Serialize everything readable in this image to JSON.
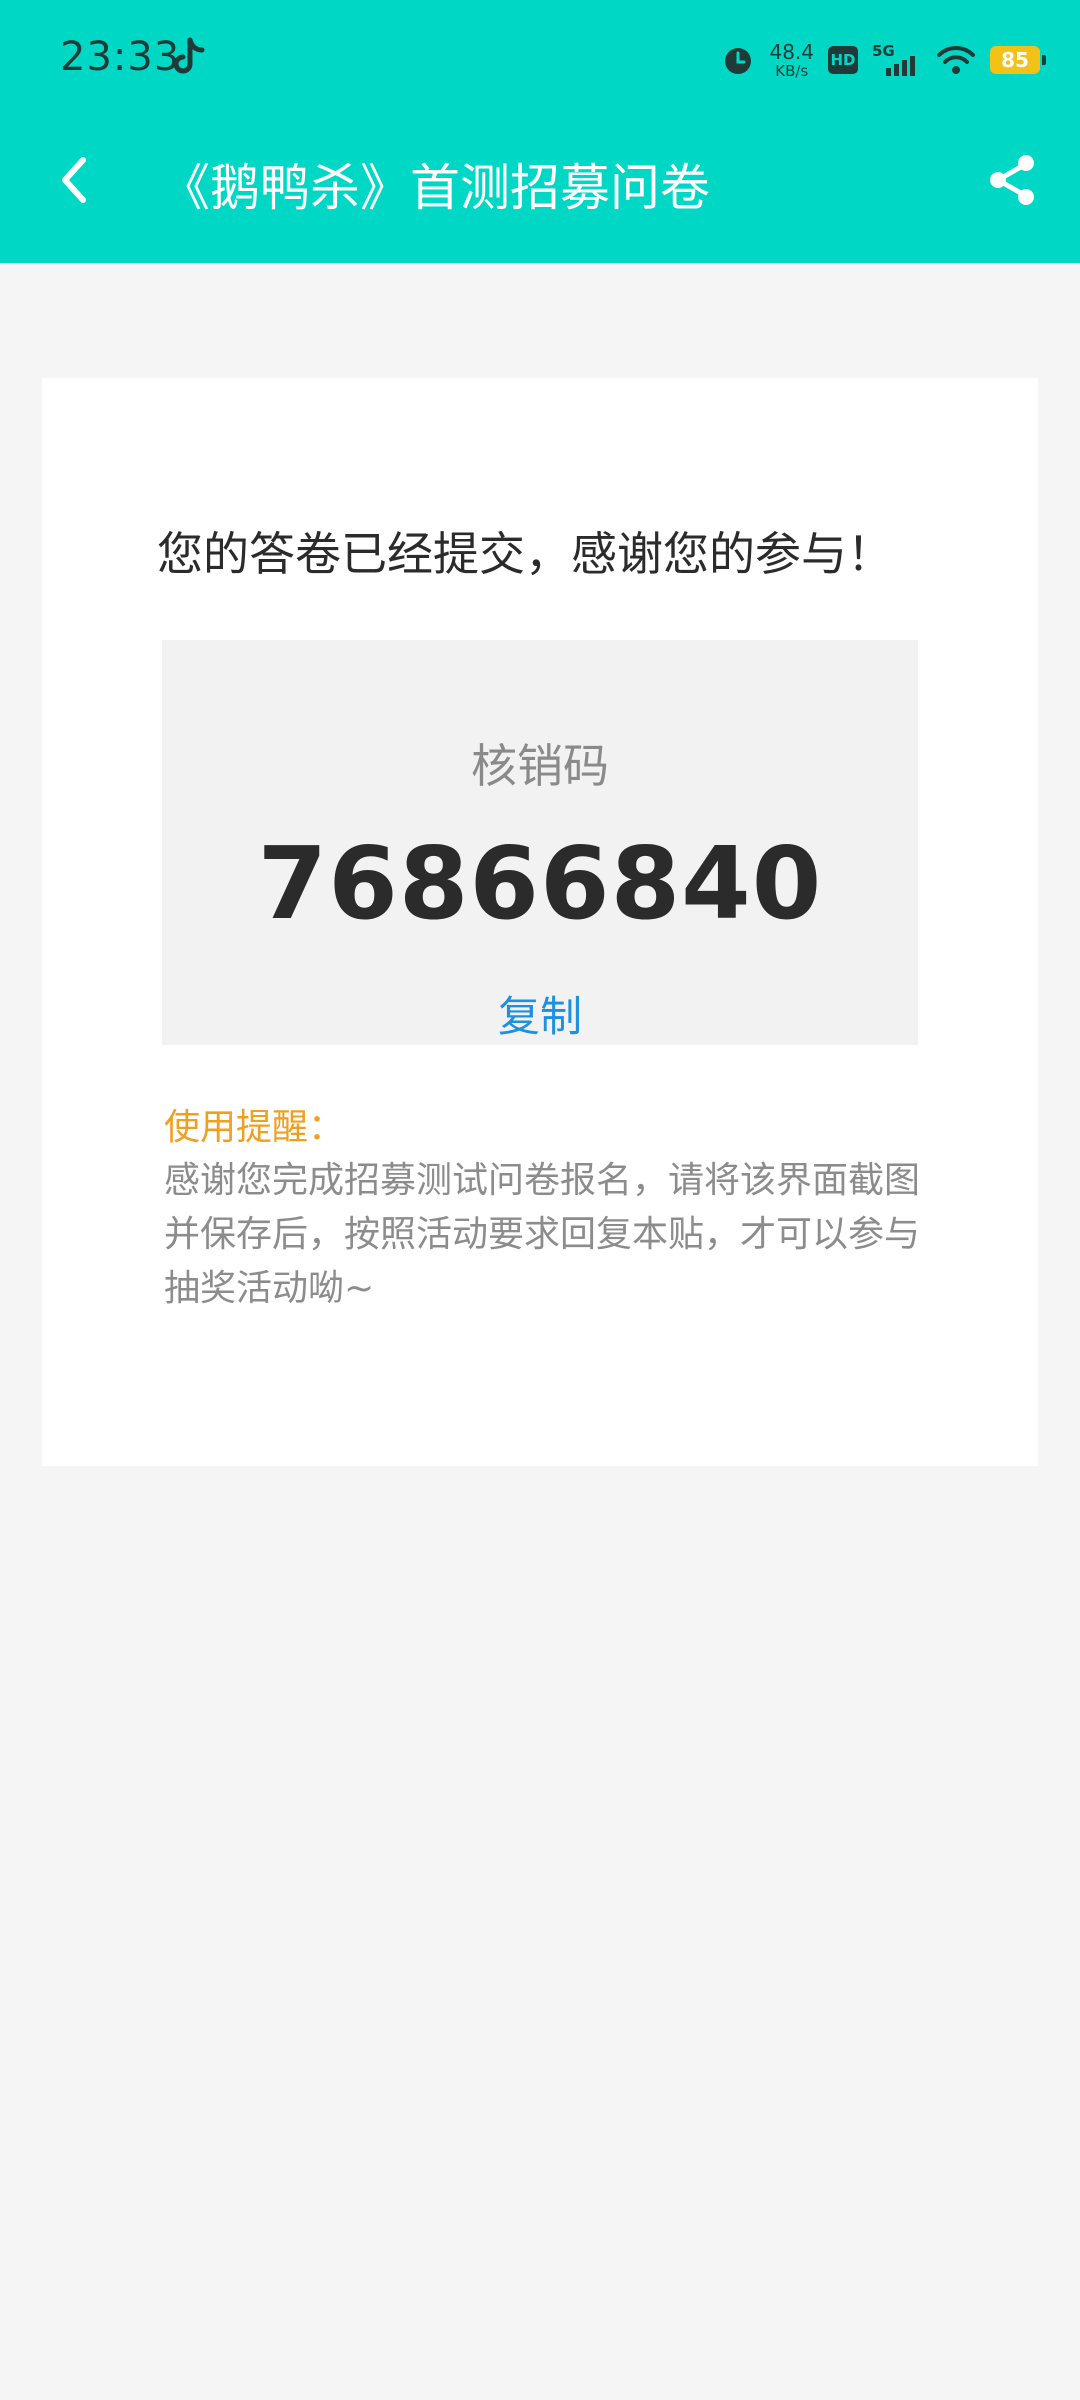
{
  "status_bar": {
    "time": "23:33",
    "net_speed_value": "48.4",
    "net_speed_unit": "KB/s",
    "hd_badge": "HD",
    "signal_label": "5G",
    "battery": "85",
    "icons": [
      "tiktok-icon",
      "alarm-icon",
      "signal-icon",
      "wifi-icon",
      "battery-icon"
    ]
  },
  "header": {
    "title": "《鹅鸭杀》首测招募问卷",
    "icons": [
      "back-arrow-icon",
      "share-icon"
    ]
  },
  "main": {
    "headline": "您的答卷已经提交，感谢您的参与！",
    "code_label": "核销码",
    "code_value": "76866840",
    "copy_label": "复制",
    "tip_title": "使用提醒：",
    "tip_text": "感谢您完成招募测试问卷报名，请将该界面截图并保存后，按照活动要求回复本贴，才可以参与抽奖活动呦~"
  },
  "colors": {
    "header_bg": "#00d7c5",
    "page_bg": "#f5f5f5",
    "link": "#1f8fe0",
    "tip_title": "#f0a020",
    "battery": "#f2c218"
  }
}
